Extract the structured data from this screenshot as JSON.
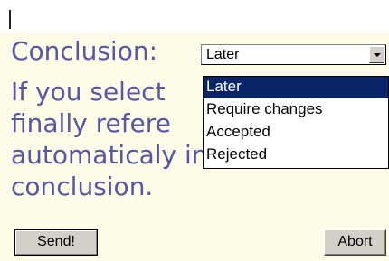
{
  "form": {
    "label": "Conclusion:"
  },
  "select": {
    "selected_value": "Later",
    "arrow_icon": "chevron-down-icon",
    "options": [
      {
        "label": "Later",
        "selected": true
      },
      {
        "label": "Require changes",
        "selected": false
      },
      {
        "label": "Accepted",
        "selected": false
      },
      {
        "label": "Rejected",
        "selected": false
      }
    ]
  },
  "message": {
    "lines": [
      "If you select",
      "finally refere",
      "automaticaly inform the",
      "conclusion."
    ]
  },
  "buttons": {
    "send_label": "Send!",
    "abort_label": "Abort"
  },
  "colors": {
    "panel_background": "#fffbe9",
    "label_text": "#5757a6",
    "selection_highlight": "#0a246a"
  }
}
